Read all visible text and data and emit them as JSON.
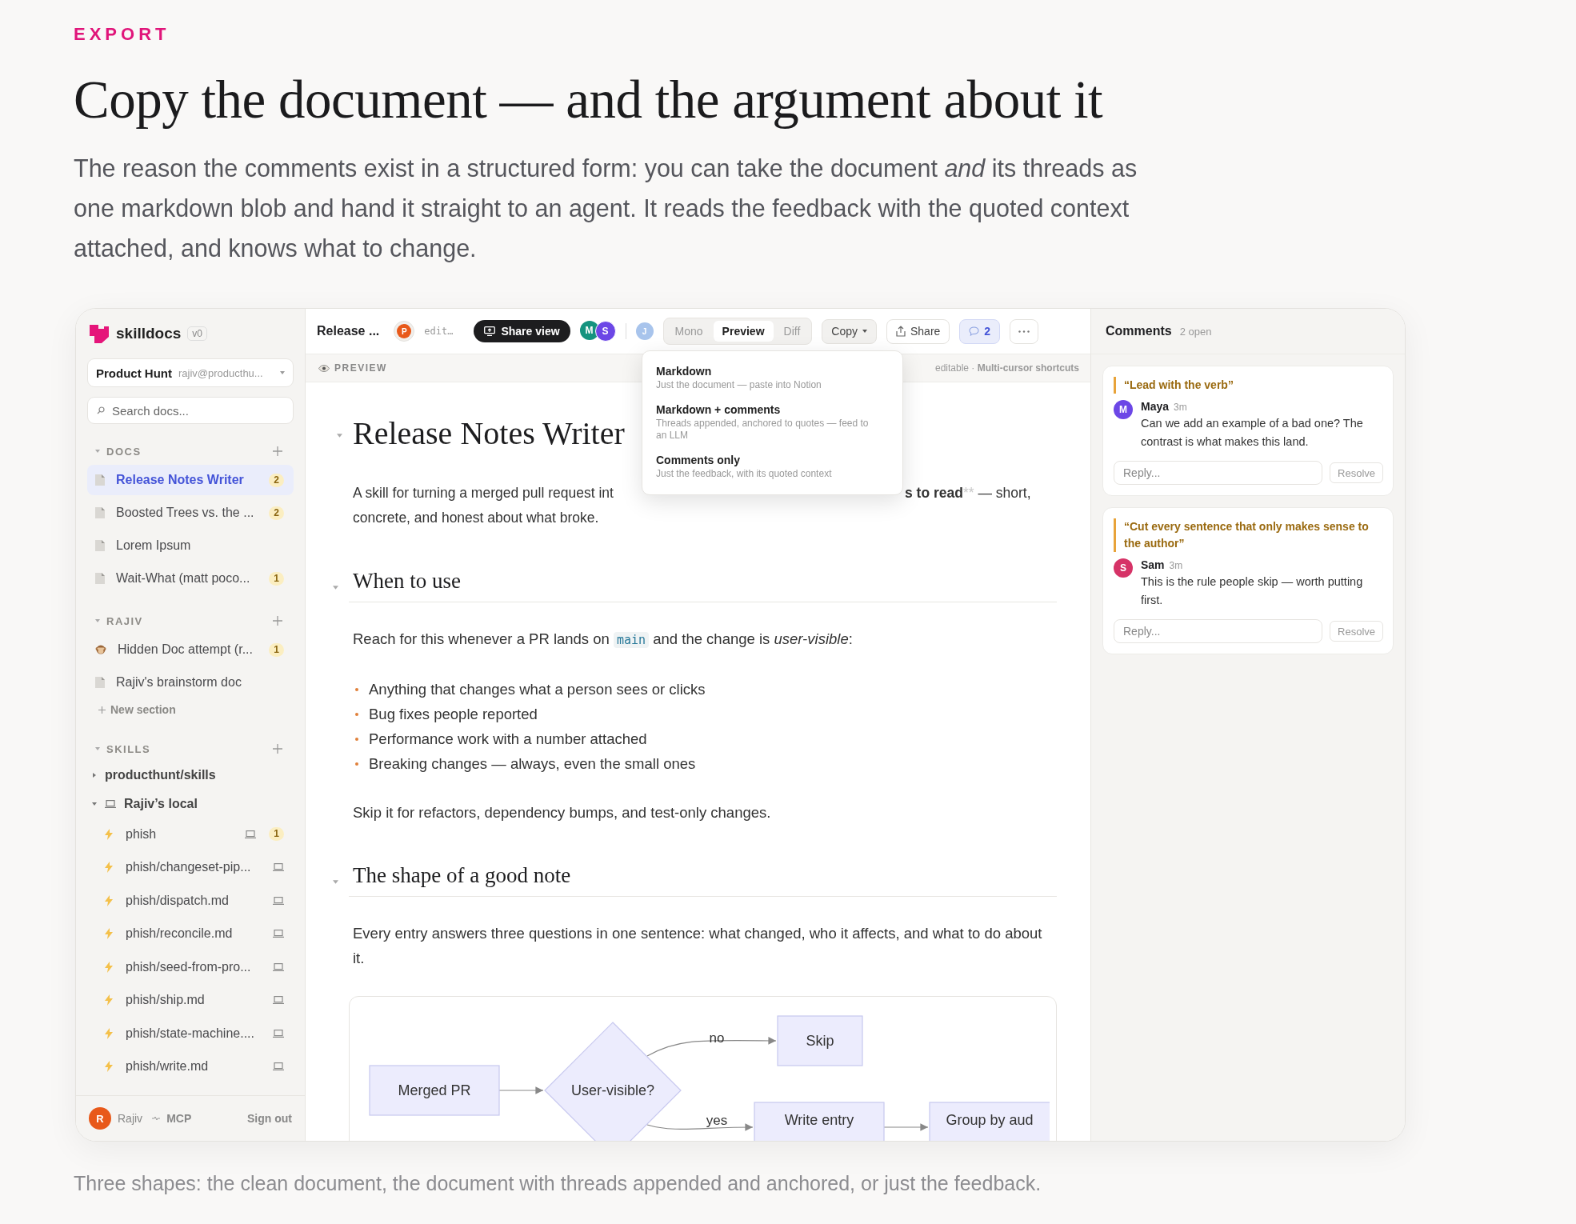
{
  "eyebrow": "EXPORT",
  "headline": "Copy the document — and the argument about it",
  "intro": "The reason the comments exist in a structured form: you can take the document *and* its threads as one markdown blob and hand it straight to an agent. It reads the feedback with the quoted context attached, and knows what to change.",
  "app": {
    "sidebar": {
      "brand": "skilldocs",
      "version": "v0",
      "workspace": {
        "name": "Product Hunt",
        "email": "rajiv@producthu..."
      },
      "search": {
        "placeholder": "Search docs..."
      },
      "sections": [
        {
          "title": "DOCS",
          "expanded": true,
          "items": [
            {
              "kind": "doc",
              "label": "Release Notes Writer",
              "badge": "2",
              "selected": true
            },
            {
              "kind": "doc",
              "label": "Boosted Trees vs. the ...",
              "badge": "2",
              "selected": false
            },
            {
              "kind": "doc",
              "label": "Lorem Ipsum",
              "selected": false
            },
            {
              "kind": "doc",
              "label": "Wait-What (matt poco...",
              "badge": "1",
              "selected": false
            }
          ]
        },
        {
          "title": "RAJIV",
          "expanded": true,
          "items": [
            {
              "kind": "hidden",
              "label": "Hidden Doc attempt (r...",
              "badge": "1",
              "selected": false
            },
            {
              "kind": "doc",
              "label": "Rajiv's brainstorm doc",
              "selected": false
            }
          ],
          "new_section": "New section"
        },
        {
          "title": "SKILLS",
          "expanded": true,
          "tree": [
            {
              "kind": "repo",
              "label": "producthunt/skills",
              "expanded": false
            },
            {
              "kind": "machine",
              "label": "Rajiv’s local",
              "expanded": true,
              "children": [
                {
                  "label": "phish",
                  "badge": "1"
                },
                {
                  "label": "phish/changeset-pip..."
                },
                {
                  "label": "phish/dispatch.md"
                },
                {
                  "label": "phish/reconcile.md"
                },
                {
                  "label": "phish/seed-from-pro..."
                },
                {
                  "label": "phish/ship.md"
                },
                {
                  "label": "phish/state-machine...."
                },
                {
                  "label": "phish/write.md"
                }
              ]
            }
          ]
        }
      ],
      "footer": {
        "initial": "R",
        "color": "#e8591a",
        "user": "Rajiv",
        "mcp": "MCP",
        "sign_out": "Sign out"
      }
    },
    "toolbar": {
      "doc_title": "Release ...",
      "presence": {
        "initial": "P",
        "color": "#e8591a"
      },
      "status": "edit…",
      "share_view": "Share view",
      "collaborators": [
        {
          "initial": "M",
          "color": "#14937f"
        },
        {
          "initial": "S",
          "color": "#6c47e6"
        }
      ],
      "viewers": [
        {
          "initial": "J",
          "color": "#a8c4ec"
        }
      ],
      "modes": [
        {
          "label": "Mono",
          "selected": false
        },
        {
          "label": "Preview",
          "selected": true
        },
        {
          "label": "Diff",
          "selected": false
        }
      ],
      "copy": {
        "label": "Copy",
        "open": true
      },
      "share": "Share",
      "comments_toggle": {
        "count": "2",
        "on": true
      }
    },
    "copy_menu": [
      {
        "title": "Markdown",
        "description": "Just the document — paste into Notion"
      },
      {
        "title": "Markdown + comments",
        "description": "Threads appended, anchored to quotes — feed to an LLM"
      },
      {
        "title": "Comments only",
        "description": "Just the feedback, with its quoted context"
      }
    ],
    "preview_bar": {
      "label": "PREVIEW",
      "hint": "editable · **Multi-cursor shortcuts**"
    },
    "document": {
      "title": "Release Notes Writer",
      "blocks": [
        {
          "kind": "covered_para",
          "before": "A skill for turning a merged pull request int",
          "bold": "s to read",
          "marker": "**",
          "after": " — short,",
          "line2": "concrete, and honest about what broke."
        },
        {
          "kind": "heading",
          "text": "When to use"
        },
        {
          "kind": "para",
          "parts": [
            {
              "text": "Reach for this whenever a PR lands on "
            },
            {
              "code": "main"
            },
            {
              "text": " and the change is *user-visible*:"
            }
          ]
        },
        {
          "kind": "list",
          "items": [
            "Anything that changes what a person sees or clicks",
            "Bug fixes people reported",
            "Performance work with a number attached",
            "Breaking changes — always, even the small ones"
          ]
        },
        {
          "kind": "para",
          "parts": [
            {
              "text": "Skip it for refactors, dependency bumps, and test-only changes."
            }
          ]
        },
        {
          "kind": "heading",
          "text": "The shape of a good note"
        },
        {
          "kind": "para",
          "parts": [
            {
              "text": "Every entry answers three questions in one sentence: what changed, who it affects, and what to do about it."
            }
          ]
        },
        {
          "kind": "flowchart",
          "nodes": [
            {
              "kind": "box",
              "label": "Merged PR"
            },
            {
              "kind": "diamond",
              "label": "User-visible?"
            },
            {
              "kind": "box",
              "label": "Skip"
            },
            {
              "kind": "box",
              "label": "Write entry"
            },
            {
              "kind": "box",
              "label": "Group by aud"
            }
          ],
          "edge_labels": [
            "no",
            "yes"
          ]
        }
      ]
    },
    "comments": {
      "title": "Comments",
      "count": "2 open",
      "threads": [
        {
          "quote": "“Lead with the verb”",
          "author": "Maya",
          "initial": "M",
          "color": "#6c47e6",
          "time": "3m",
          "body": "Can we add an example of a bad one? The contrast is what makes this land.",
          "reply_placeholder": "Reply...",
          "resolve": "Resolve"
        },
        {
          "quote": "“Cut every sentence that only makes sense to the author”",
          "author": "Sam",
          "initial": "S",
          "color": "#d63367",
          "time": "3m",
          "body": "This is the rule people skip — worth putting first.",
          "reply_placeholder": "Reply...",
          "resolve": "Resolve"
        }
      ]
    }
  },
  "caption": "Three shapes: the clean document, the document with threads appended and anchored, or just the feedback."
}
